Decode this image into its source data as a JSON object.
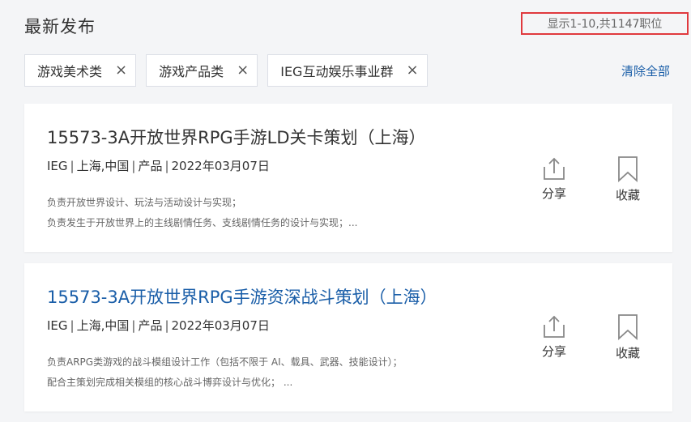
{
  "header": {
    "title": "最新发布",
    "result_count": "显示1-10,共1147职位"
  },
  "filters": {
    "chips": [
      {
        "label": "游戏美术类"
      },
      {
        "label": "游戏产品类"
      },
      {
        "label": "IEG互动娱乐事业群"
      }
    ],
    "close_glyph": "×",
    "clear_all": "清除全部"
  },
  "jobs": [
    {
      "title": "15573-3A开放世界RPG手游LD关卡策划（上海）",
      "bg": "IEG",
      "location": "上海,中国",
      "category": "产品",
      "date": "2022年03月07日",
      "desc_line1": "负责开放世界设计、玩法与活动设计与实现；",
      "desc_line2": "负责发生于开放世界上的主线剧情任务、支线剧情任务的设计与实现；...",
      "share_label": "分享",
      "fav_label": "收藏"
    },
    {
      "title": "15573-3A开放世界RPG手游资深战斗策划（上海）",
      "bg": "IEG",
      "location": "上海,中国",
      "category": "产品",
      "date": "2022年03月07日",
      "desc_line1": "负责ARPG类游戏的战斗模组设计工作（包括不限于 AI、载具、武器、技能设计）；",
      "desc_line2": "配合主策划完成相关模组的核心战斗博弈设计与优化；  ...",
      "share_label": "分享",
      "fav_label": "收藏"
    }
  ],
  "colors": {
    "link_blue": "#1a5ea8",
    "highlight_red": "#e0393e",
    "page_bg": "#f4f5f7"
  },
  "icons": {
    "share": "share-icon",
    "favorite": "bookmark-icon",
    "close": "close-icon"
  }
}
